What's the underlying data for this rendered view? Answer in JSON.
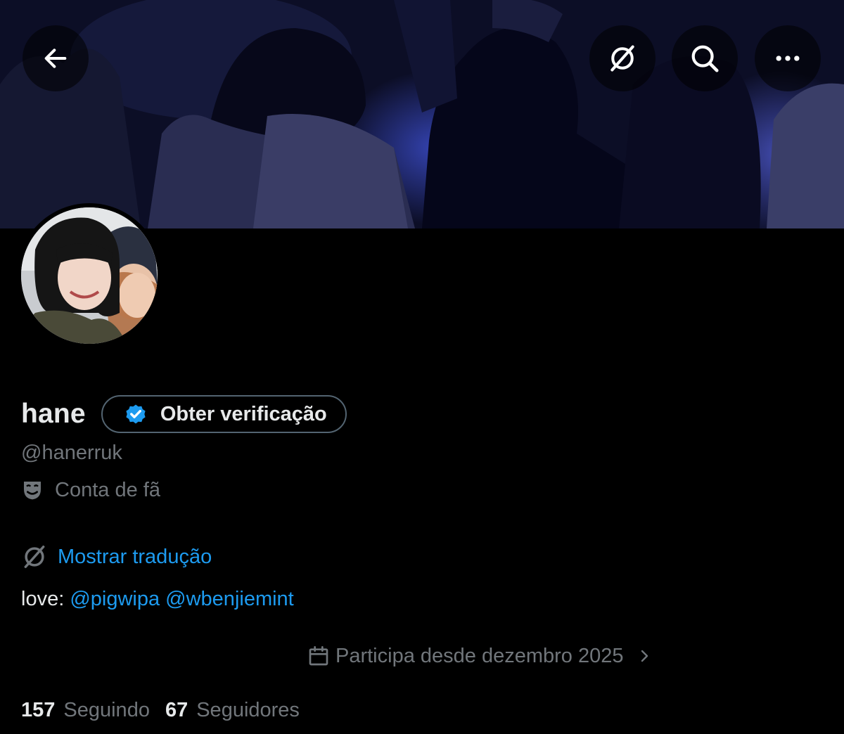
{
  "header": {
    "back_icon": "arrow-left-icon",
    "translate_icon": "no-translation-icon",
    "search_icon": "search-icon",
    "more_icon": "more-dots-icon"
  },
  "profile": {
    "display_name": "hane",
    "verify_button": "Obter verificação",
    "handle": "@hanerruk",
    "category": "Conta de fã",
    "category_icon": "theater-mask-icon",
    "show_translation": "Mostrar tradução",
    "bio_prefix": "love:",
    "mentions": [
      "@pigwipa",
      "@wbenjiemint"
    ],
    "joined": "Participa desde dezembro 2025",
    "joined_icon": "calendar-icon"
  },
  "stats": {
    "following_count": "157",
    "following_label": "Seguindo",
    "followers_count": "67",
    "followers_label": "Seguidores"
  },
  "colors": {
    "background": "#000000",
    "primary_text": "#e7e9ea",
    "secondary_text": "#71767b",
    "accent_blue": "#1d9bf0",
    "border": "#536471"
  }
}
